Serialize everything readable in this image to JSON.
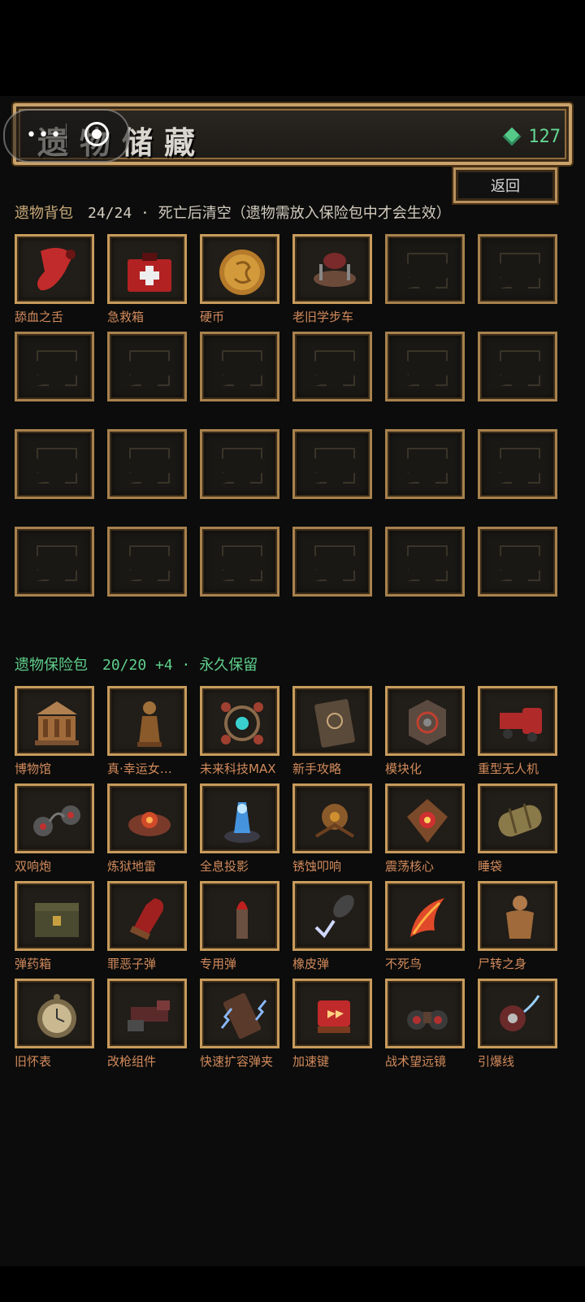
{
  "title": "遗物储藏",
  "currency": {
    "icon": "gem-icon",
    "amount": "127",
    "color": "#63d693"
  },
  "back_label": "返回",
  "backpack": {
    "name": "遗物背包",
    "info": "24/24 · 死亡后清空（遗物需放入保险包中才会生效）",
    "items": [
      {
        "label": "舔血之舌",
        "icon": "tongue-icon"
      },
      {
        "label": "急救箱",
        "icon": "first-aid-kit-icon"
      },
      {
        "label": "硬币",
        "icon": "coin-icon"
      },
      {
        "label": "老旧学步车",
        "icon": "baby-walker-icon"
      },
      {
        "label": "",
        "icon": ""
      },
      {
        "label": "",
        "icon": ""
      },
      {
        "label": "",
        "icon": ""
      },
      {
        "label": "",
        "icon": ""
      },
      {
        "label": "",
        "icon": ""
      },
      {
        "label": "",
        "icon": ""
      },
      {
        "label": "",
        "icon": ""
      },
      {
        "label": "",
        "icon": ""
      },
      {
        "label": "",
        "icon": ""
      },
      {
        "label": "",
        "icon": ""
      },
      {
        "label": "",
        "icon": ""
      },
      {
        "label": "",
        "icon": ""
      },
      {
        "label": "",
        "icon": ""
      },
      {
        "label": "",
        "icon": ""
      },
      {
        "label": "",
        "icon": ""
      },
      {
        "label": "",
        "icon": ""
      },
      {
        "label": "",
        "icon": ""
      },
      {
        "label": "",
        "icon": ""
      },
      {
        "label": "",
        "icon": ""
      },
      {
        "label": "",
        "icon": ""
      }
    ]
  },
  "vault": {
    "name": "遗物保险包",
    "info": "20/20 +4 · 永久保留",
    "items": [
      {
        "label": "博物馆",
        "icon": "museum-icon"
      },
      {
        "label": "真·幸运女…",
        "icon": "statue-icon"
      },
      {
        "label": "未来科技MAX",
        "icon": "tech-core-icon"
      },
      {
        "label": "新手攻略",
        "icon": "guide-book-icon"
      },
      {
        "label": "模块化",
        "icon": "module-icon"
      },
      {
        "label": "重型无人机",
        "icon": "drone-icon"
      },
      {
        "label": "双响炮",
        "icon": "double-mace-icon"
      },
      {
        "label": "炼狱地雷",
        "icon": "landmine-icon"
      },
      {
        "label": "全息投影",
        "icon": "hologram-icon"
      },
      {
        "label": "锈蚀叩响",
        "icon": "rust-gear-icon"
      },
      {
        "label": "震荡核心",
        "icon": "shock-core-icon"
      },
      {
        "label": "睡袋",
        "icon": "sleeping-bag-icon"
      },
      {
        "label": "弹药箱",
        "icon": "ammo-box-icon"
      },
      {
        "label": "罪恶子弹",
        "icon": "sin-bullet-icon"
      },
      {
        "label": "专用弹",
        "icon": "bullet-icon"
      },
      {
        "label": "橡皮弹",
        "icon": "rubber-bullet-icon"
      },
      {
        "label": "不死鸟",
        "icon": "phoenix-feather-icon"
      },
      {
        "label": "尸转之身",
        "icon": "corpse-body-icon"
      },
      {
        "label": "旧怀表",
        "icon": "pocket-watch-icon"
      },
      {
        "label": "改枪组件",
        "icon": "gun-parts-icon"
      },
      {
        "label": "快速扩容弹夹",
        "icon": "magazine-icon"
      },
      {
        "label": "加速键",
        "icon": "boost-key-icon"
      },
      {
        "label": "战术望远镜",
        "icon": "binoculars-icon"
      },
      {
        "label": "引爆线",
        "icon": "detonator-wire-icon"
      }
    ]
  },
  "colors": {
    "backpack_title": "#c9a97a",
    "backpack_info": "#d3cbbf",
    "vault_title": "#5fcf8c",
    "label": "#d38a5c",
    "frame": "#a8814d"
  }
}
